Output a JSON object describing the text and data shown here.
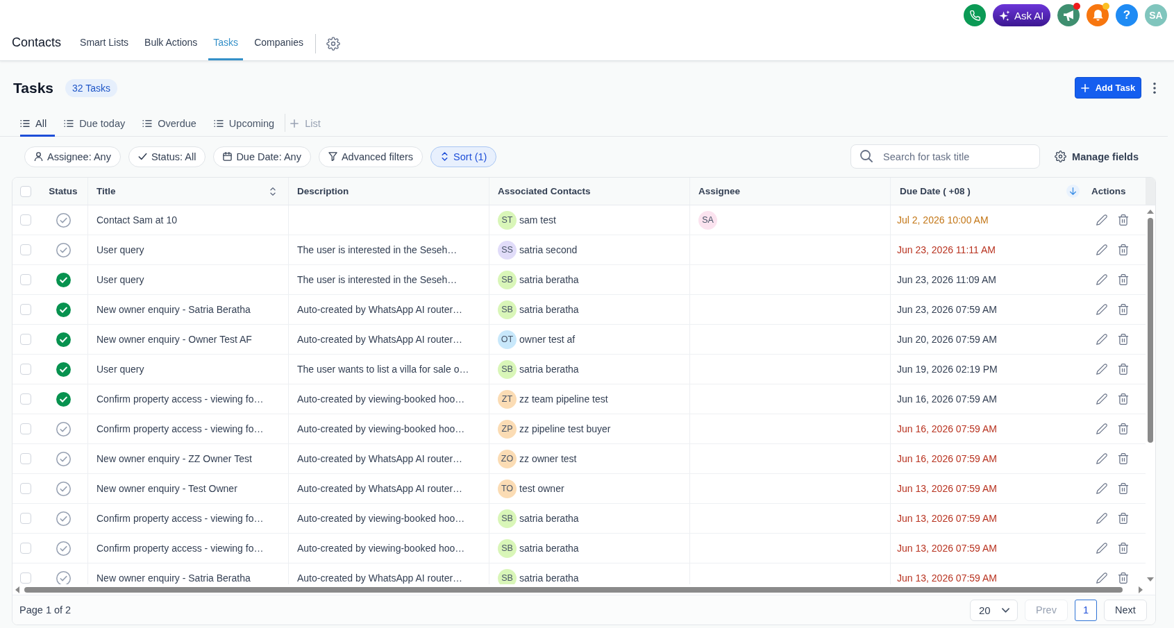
{
  "top_bar": {
    "actions": [
      {
        "kind": "phone"
      },
      {
        "kind": "ask_ai",
        "label": "Ask AI"
      },
      {
        "kind": "announcements",
        "unread": true,
        "dot": {
          "color": "#ef1b1b"
        }
      },
      {
        "kind": "notifications",
        "unread": true,
        "dot": {
          "color": "#fbbf24"
        }
      },
      {
        "kind": "help",
        "label": "?"
      },
      {
        "kind": "avatar",
        "label": "SA"
      }
    ]
  },
  "nav": {
    "title": "Contacts",
    "items": [
      {
        "label": "Smart Lists",
        "selected": false
      },
      {
        "label": "Bulk Actions",
        "selected": false
      },
      {
        "label": "Tasks",
        "selected": true
      },
      {
        "label": "Companies",
        "selected": false
      }
    ]
  },
  "header": {
    "title": "Tasks",
    "count": "32 Tasks",
    "add_button": "Add Task"
  },
  "views": {
    "tabs": [
      {
        "label": "All",
        "selected": true
      },
      {
        "label": "Due today",
        "selected": false
      },
      {
        "label": "Overdue",
        "selected": false
      },
      {
        "label": "Upcoming",
        "selected": false
      }
    ],
    "add_label": "List"
  },
  "filters": [
    {
      "kind": "assignee",
      "label": "Assignee: Any",
      "active": false
    },
    {
      "kind": "status",
      "label": "Status: All",
      "active": false
    },
    {
      "kind": "due_date",
      "label": "Due Date: Any",
      "active": false
    },
    {
      "kind": "advanced",
      "label": "Advanced filters",
      "active": false
    },
    {
      "kind": "sort",
      "label": "Sort (1)",
      "active": true
    }
  ],
  "search": {
    "placeholder": "Search for task title"
  },
  "manage_fields": "Manage fields",
  "table": {
    "select_all": {
      "checked": false
    },
    "columns": [
      {
        "label": "Status"
      },
      {
        "label": "Title",
        "sorted": false
      },
      {
        "label": "Description"
      },
      {
        "label": "Associated Contacts"
      },
      {
        "label": "Assignee"
      },
      {
        "label": "Due Date ( +08 )",
        "sorted": true
      },
      {
        "label": "Actions"
      }
    ],
    "rows": [
      {
        "checked": false,
        "done": false,
        "title": "Contact Sam at 10",
        "contact": {
          "initials": "ST",
          "name": "sam test",
          "color": "#d9f6b8"
        },
        "assignee": {
          "initials": "SA",
          "color": "#fbe3ef"
        },
        "due": {
          "text": "Jul 2, 2026 10:00 AM",
          "color": "#c37616"
        }
      },
      {
        "checked": false,
        "done": false,
        "title": "User query",
        "description": "The user is interested in the Seseh…",
        "contact": {
          "initials": "SS",
          "name": "satria second",
          "color": "#e1dcf9"
        },
        "due": {
          "text": "Jun 23, 2026 11:11 AM",
          "color": "#b8321f"
        }
      },
      {
        "checked": false,
        "done": true,
        "title": "User query",
        "description": "The user is interested in the Seseh…",
        "contact": {
          "initials": "SB",
          "name": "satria beratha",
          "color": "#d9f6b8"
        },
        "due": {
          "text": "Jun 23, 2026 11:09 AM",
          "color": "#344054"
        }
      },
      {
        "checked": false,
        "done": true,
        "title": "New owner enquiry - Satria Beratha",
        "description": "Auto-created by WhatsApp AI router…",
        "contact": {
          "initials": "SB",
          "name": "satria beratha",
          "color": "#d9f6b8"
        },
        "due": {
          "text": "Jun 23, 2026 07:59 AM",
          "color": "#344054"
        }
      },
      {
        "checked": false,
        "done": true,
        "title": "New owner enquiry - Owner Test AF",
        "description": "Auto-created by WhatsApp AI router…",
        "contact": {
          "initials": "OT",
          "name": "owner test af",
          "color": "#c8e8fb"
        },
        "due": {
          "text": "Jun 20, 2026 07:59 AM",
          "color": "#344054"
        }
      },
      {
        "checked": false,
        "done": true,
        "title": "User query",
        "description": "The user wants to list a villa for sale o…",
        "contact": {
          "initials": "SB",
          "name": "satria beratha",
          "color": "#d9f6b8"
        },
        "due": {
          "text": "Jun 19, 2026 02:19 PM",
          "color": "#344054"
        }
      },
      {
        "checked": false,
        "done": true,
        "title": "Confirm property access - viewing fo…",
        "description": "Auto-created by viewing-booked hoo…",
        "contact": {
          "initials": "ZT",
          "name": "zz team pipeline test",
          "color": "#fbdcb4"
        },
        "due": {
          "text": "Jun 16, 2026 07:59 AM",
          "color": "#344054"
        }
      },
      {
        "checked": false,
        "done": false,
        "title": "Confirm property access - viewing fo…",
        "description": "Auto-created by viewing-booked hoo…",
        "contact": {
          "initials": "ZP",
          "name": "zz pipeline test buyer",
          "color": "#fbdcb4"
        },
        "due": {
          "text": "Jun 16, 2026 07:59 AM",
          "color": "#b8321f"
        }
      },
      {
        "checked": false,
        "done": false,
        "title": "New owner enquiry - ZZ Owner Test",
        "description": "Auto-created by WhatsApp AI router…",
        "contact": {
          "initials": "ZO",
          "name": "zz owner test",
          "color": "#fbdcb4"
        },
        "due": {
          "text": "Jun 16, 2026 07:59 AM",
          "color": "#b8321f"
        }
      },
      {
        "checked": false,
        "done": false,
        "title": "New owner enquiry - Test Owner",
        "description": "Auto-created by WhatsApp AI router…",
        "contact": {
          "initials": "TO",
          "name": "test owner",
          "color": "#fbdcb4"
        },
        "due": {
          "text": "Jun 13, 2026 07:59 AM",
          "color": "#b8321f"
        }
      },
      {
        "checked": false,
        "done": false,
        "title": "Confirm property access - viewing fo…",
        "description": "Auto-created by viewing-booked hoo…",
        "contact": {
          "initials": "SB",
          "name": "satria beratha",
          "color": "#d9f6b8"
        },
        "due": {
          "text": "Jun 13, 2026 07:59 AM",
          "color": "#b8321f"
        }
      },
      {
        "checked": false,
        "done": false,
        "title": "Confirm property access - viewing fo…",
        "description": "Auto-created by viewing-booked hoo…",
        "contact": {
          "initials": "SB",
          "name": "satria beratha",
          "color": "#d9f6b8"
        },
        "due": {
          "text": "Jun 13, 2026 07:59 AM",
          "color": "#b8321f"
        }
      },
      {
        "checked": false,
        "done": false,
        "title": "New owner enquiry - Satria Beratha",
        "description": "Auto-created by WhatsApp AI router…",
        "contact": {
          "initials": "SB",
          "name": "satria beratha",
          "color": "#d9f6b8"
        },
        "due": {
          "text": "Jun 13, 2026 07:59 AM",
          "color": "#b8321f"
        }
      }
    ]
  },
  "pagination": {
    "summary": "Page 1 of 2",
    "page_size": "20",
    "prev": {
      "label": "Prev",
      "disabled": true
    },
    "pages": [
      {
        "label": "1",
        "selected": true
      }
    ],
    "next": {
      "label": "Next",
      "disabled": false
    }
  }
}
